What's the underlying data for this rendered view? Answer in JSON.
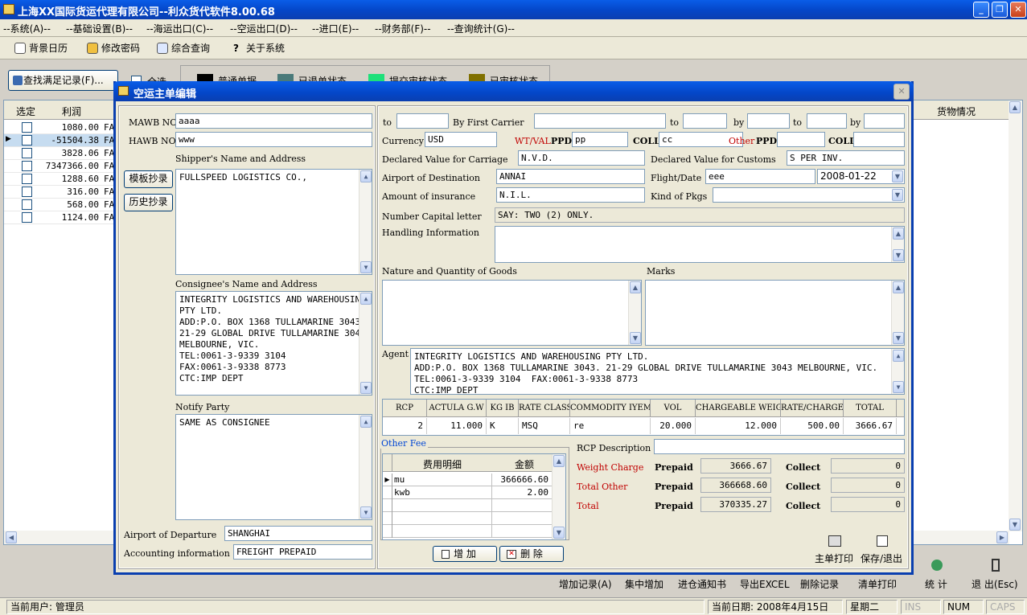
{
  "window": {
    "title": "上海XX国际货运代理有限公司--利众货代软件8.00.68"
  },
  "menu": [
    "--系统(A)--",
    "--基础设置(B)--",
    "--海运出口(C)--",
    "--空运出口(D)--",
    "--进口(E)--",
    "--财务部(F)--",
    "--查询统计(G)--"
  ],
  "toolbar": {
    "calendar": "背景日历",
    "password": "修改密码",
    "query": "综合查询",
    "about": "关于系统"
  },
  "filter": {
    "find": "查找满足记录(F)...",
    "select_all": "全选",
    "legend": [
      "普通单据",
      "已退单状态",
      "提交审核状态",
      "已审核状态"
    ],
    "legend_colors": [
      "#000000",
      "#4a7a7a",
      "#1ee07a",
      "#807000"
    ]
  },
  "grid": {
    "col_select": "选定",
    "col_profit": "利润",
    "col_goods": "货物情况",
    "rows": [
      {
        "profit": "1080.00",
        "tail": "FA"
      },
      {
        "profit": "-51504.38",
        "tail": "FA"
      },
      {
        "profit": "3828.06",
        "tail": "FA"
      },
      {
        "profit": "7347366.00",
        "tail": "FA"
      },
      {
        "profit": "1288.60",
        "tail": "FA"
      },
      {
        "profit": "316.00",
        "tail": "FA"
      },
      {
        "profit": "568.00",
        "tail": "FA"
      },
      {
        "profit": "1124.00",
        "tail": "FA"
      }
    ]
  },
  "bottom_actions": [
    "增加记录(A)",
    "集中增加",
    "进仓通知书",
    "导出EXCEL",
    "删除记录",
    "清单打印"
  ],
  "stat": "统 计",
  "exit": "退 出(Esc)",
  "status": {
    "user": "当前用户: 管理员",
    "date": "当前日期: 2008年4月15日",
    "weekday": "星期二",
    "ins": "INS",
    "num": "NUM",
    "caps": "CAPS"
  },
  "dialog": {
    "title": "空运主单编辑",
    "mawb_label": "MAWB NO.",
    "mawb": "aaaa",
    "hawb_label": "HAWB NO.",
    "hawb": "www",
    "shipper_label": "Shipper's Name and Address",
    "shipper": "FULLSPEED LOGISTICS CO.,",
    "btn_template": "模板抄录",
    "btn_history": "历史抄录",
    "consignee_label": "Consignee's Name and Address",
    "consignee": "INTEGRITY LOGISTICS AND WAREHOUSING\nPTY LTD.\nADD:P.O. BOX 1368 TULLAMARINE 3043.\n21-29 GLOBAL DRIVE TULLAMARINE 3043\nMELBOURNE, VIC.\nTEL:0061-3-9339 3104\nFAX:0061-3-9338 8773\nCTC:IMP DEPT",
    "notify_label": "Notify Party",
    "notify": "SAME AS CONSIGNEE",
    "departure_label": "Airport of Departure",
    "departure": "SHANGHAI",
    "accounting_label": "Accounting information",
    "accounting": "FREIGHT PREPAID",
    "to_label": "to",
    "by_first_label": "By First Carrier",
    "by_label": "by",
    "currency_label": "Currency",
    "currency": "USD",
    "wtval_label": "WT/VAL",
    "ppd_label": "PPD",
    "wt_ppd": "pp",
    "coll_label": "COLL",
    "wt_coll": "cc",
    "other_label": "Other",
    "other_ppd": "",
    "other_coll": "",
    "dvc_label": "Declared Value for Carriage",
    "dvc": "N.V.D.",
    "dvcu_label": "Declared Value for Customs",
    "dvcu": "S PER INV.",
    "dest_label": "Airport of Destination",
    "dest": "ANNAI",
    "flight_label": "Flight/Date",
    "flight": "eee",
    "flight_date": "2008-01-22",
    "ins_label": "Amount of insurance",
    "ins": "N.I.L.",
    "kind_label": "Kind of Pkgs",
    "kind": "",
    "capital_label": "Number Capital letter",
    "capital": "SAY: TWO (2) ONLY.",
    "handling_label": "Handling Information",
    "nature_label": "Nature and Quantity of Goods",
    "marks_label": "Marks",
    "agent_label": "Agent",
    "agent": "INTEGRITY LOGISTICS AND WAREHOUSING PTY LTD.\nADD:P.O. BOX 1368 TULLAMARINE 3043. 21-29 GLOBAL DRIVE TULLAMARINE 3043 MELBOURNE, VIC.\nTEL:0061-3-9339 3104  FAX:0061-3-9338 8773\nCTC:IMP DEPT",
    "rate_headers": [
      "RCP",
      "ACTULA G.W",
      "KG IB",
      "RATE CLASS",
      "COMMODITY IYEM N",
      "VOL",
      "CHARGEABLE WEIGHT",
      "RATE/CHARGE",
      "TOTAL"
    ],
    "rate_row": [
      "2",
      "11.000",
      "K",
      "MSQ",
      "re",
      "20.000",
      "12.000",
      "500.00",
      "3666.67"
    ],
    "other_fee_label": "Other Fee",
    "fee_col_item": "费用明细",
    "fee_col_amount": "金额",
    "fees": [
      {
        "item": "mu",
        "amount": "366666.60"
      },
      {
        "item": "kwb",
        "amount": "2.00"
      }
    ],
    "btn_add": "增 加",
    "btn_delete": "删 除",
    "rcp_desc_label": "RCP Description",
    "rcp_desc": "",
    "weight_charge_label": "Weight Charge",
    "total_other_label": "Total Other",
    "total_label": "Total",
    "prepaid_label": "Prepaid",
    "collect_label": "Collect",
    "weight_prepaid": "3666.67",
    "weight_collect": "0",
    "other_prepaid": "366668.60",
    "other_collect": "0",
    "total_prepaid": "370335.27",
    "total_collect": "0",
    "print_label": "主单打印",
    "save_label": "保存/退出"
  }
}
